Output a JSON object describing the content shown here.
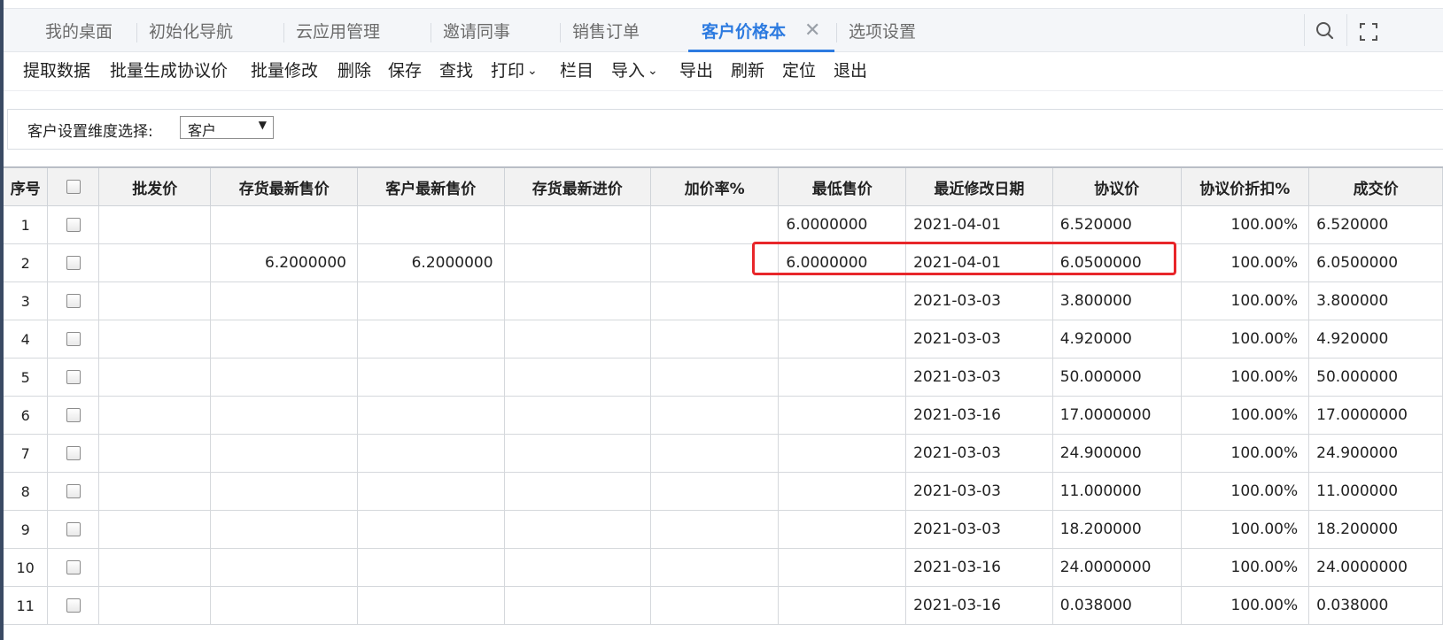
{
  "tabs": [
    {
      "label": "我的桌面",
      "active": false
    },
    {
      "label": "初始化导航",
      "active": false
    },
    {
      "label": "云应用管理",
      "active": false
    },
    {
      "label": "邀请同事",
      "active": false
    },
    {
      "label": "销售订单",
      "active": false
    },
    {
      "label": "客户价格本",
      "active": true,
      "close": "✕"
    },
    {
      "label": "选项设置",
      "active": false
    }
  ],
  "toolbar": {
    "items": [
      "提取数据",
      "批量生成协议价",
      "批量修改",
      "删除",
      "保存",
      "查找",
      "打印",
      "栏目",
      "导入",
      "导出",
      "刷新",
      "定位",
      "退出"
    ]
  },
  "filter": {
    "label": "客户设置维度选择:",
    "selected": "客户"
  },
  "table": {
    "columns": [
      "序号",
      "",
      "批发价",
      "存货最新售价",
      "客户最新售价",
      "存货最新进价",
      "加价率%",
      "最低售价",
      "最近修改日期",
      "协议价",
      "协议价折扣%",
      "成交价"
    ],
    "rows": [
      [
        "1",
        "",
        "",
        "",
        "",
        "",
        "",
        "6.0000000",
        "2021-04-01",
        "6.520000",
        "100.00%",
        "6.520000"
      ],
      [
        "2",
        "",
        "",
        "6.2000000",
        "6.2000000",
        "",
        "",
        "6.0000000",
        "2021-04-01",
        "6.0500000",
        "100.00%",
        "6.0500000"
      ],
      [
        "3",
        "",
        "",
        "",
        "",
        "",
        "",
        "",
        "2021-03-03",
        "3.800000",
        "100.00%",
        "3.800000"
      ],
      [
        "4",
        "",
        "",
        "",
        "",
        "",
        "",
        "",
        "2021-03-03",
        "4.920000",
        "100.00%",
        "4.920000"
      ],
      [
        "5",
        "",
        "",
        "",
        "",
        "",
        "",
        "",
        "2021-03-03",
        "50.000000",
        "100.00%",
        "50.000000"
      ],
      [
        "6",
        "",
        "",
        "",
        "",
        "",
        "",
        "",
        "2021-03-16",
        "17.0000000",
        "100.00%",
        "17.0000000"
      ],
      [
        "7",
        "",
        "",
        "",
        "",
        "",
        "",
        "",
        "2021-03-03",
        "24.900000",
        "100.00%",
        "24.900000"
      ],
      [
        "8",
        "",
        "",
        "",
        "",
        "",
        "",
        "",
        "2021-03-03",
        "11.000000",
        "100.00%",
        "11.000000"
      ],
      [
        "9",
        "",
        "",
        "",
        "",
        "",
        "",
        "",
        "2021-03-03",
        "18.200000",
        "100.00%",
        "18.200000"
      ],
      [
        "10",
        "",
        "",
        "",
        "",
        "",
        "",
        "",
        "2021-03-16",
        "24.0000000",
        "100.00%",
        "24.0000000"
      ],
      [
        "11",
        "",
        "",
        "",
        "",
        "",
        "",
        "",
        "2021-03-16",
        "0.038000",
        "100.00%",
        "0.038000"
      ]
    ]
  },
  "icons": {
    "search": "search-icon",
    "fullscreen": "fullscreen-icon"
  },
  "colors": {
    "accent": "#2d7be0",
    "highlight_border": "#e8262a"
  }
}
